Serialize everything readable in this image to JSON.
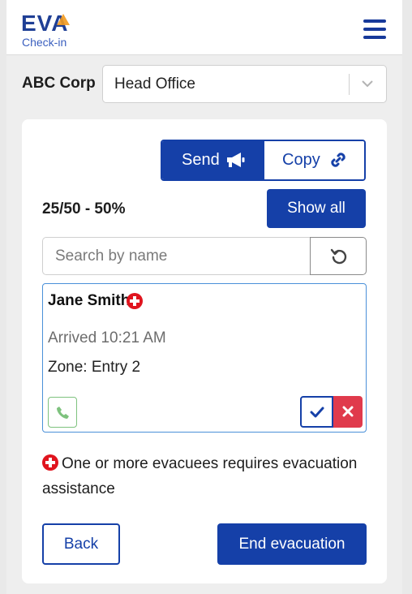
{
  "header": {
    "logo_main": "EVA",
    "logo_sub": "Check-in",
    "menu_icon": "hamburger-menu-icon"
  },
  "org": {
    "company": "ABC Corp",
    "location": "Head Office"
  },
  "actions": {
    "send_label": "Send",
    "send_icon": "megaphone-icon",
    "copy_label": "Copy",
    "copy_icon": "link-icon"
  },
  "summary": {
    "count_text": "25/50 - 50%",
    "show_all_label": "Show all"
  },
  "search": {
    "placeholder": "Search by name",
    "reset_icon": "refresh-icon"
  },
  "evacuee": {
    "name": "Jane Smith",
    "arrived": "Arrived 10:21 AM",
    "zone": "Zone: Entry 2",
    "requires_assistance": true
  },
  "note": {
    "text": "One or more evacuees requires evacuation assistance"
  },
  "footer": {
    "back_label": "Back",
    "end_label": "End evacuation"
  },
  "colors": {
    "primary": "#1540a8",
    "danger": "#e03a4c",
    "assist_red": "#e0141e",
    "call_green": "#7ec27e",
    "logo_accent": "#f29a1f"
  }
}
